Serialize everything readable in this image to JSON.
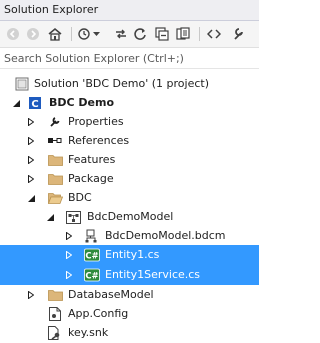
{
  "window": {
    "title": "Solution Explorer"
  },
  "toolbar": {
    "icons": [
      "back-icon",
      "forward-icon",
      "home-icon",
      "sync-history-icon",
      "dropdown-arrow-icon",
      "pending-changes-icon",
      "refresh-icon",
      "collapse-all-icon",
      "show-all-files-icon",
      "code-view-icon",
      "properties-icon"
    ]
  },
  "search": {
    "placeholder": "Search Solution Explorer (Ctrl+;)",
    "value": ""
  },
  "tree": {
    "solution": "Solution 'BDC Demo' (1 project)",
    "project": "BDC Demo",
    "properties": "Properties",
    "references": "References",
    "features": "Features",
    "package": "Package",
    "bdc": "BDC",
    "bdc_model": "BdcDemoModel",
    "bdcm_file": "BdcDemoModel.bdcm",
    "entity1": "Entity1.cs",
    "entity1_service": "Entity1Service.cs",
    "database_model": "DatabaseModel",
    "app_config": "App.Config",
    "key_snk": "key.snk"
  },
  "colors": {
    "selection": "#3399ff",
    "project_icon": "#1e5bbf",
    "folder": "#dcb67a",
    "cs_icon": "#2e8b3d"
  }
}
